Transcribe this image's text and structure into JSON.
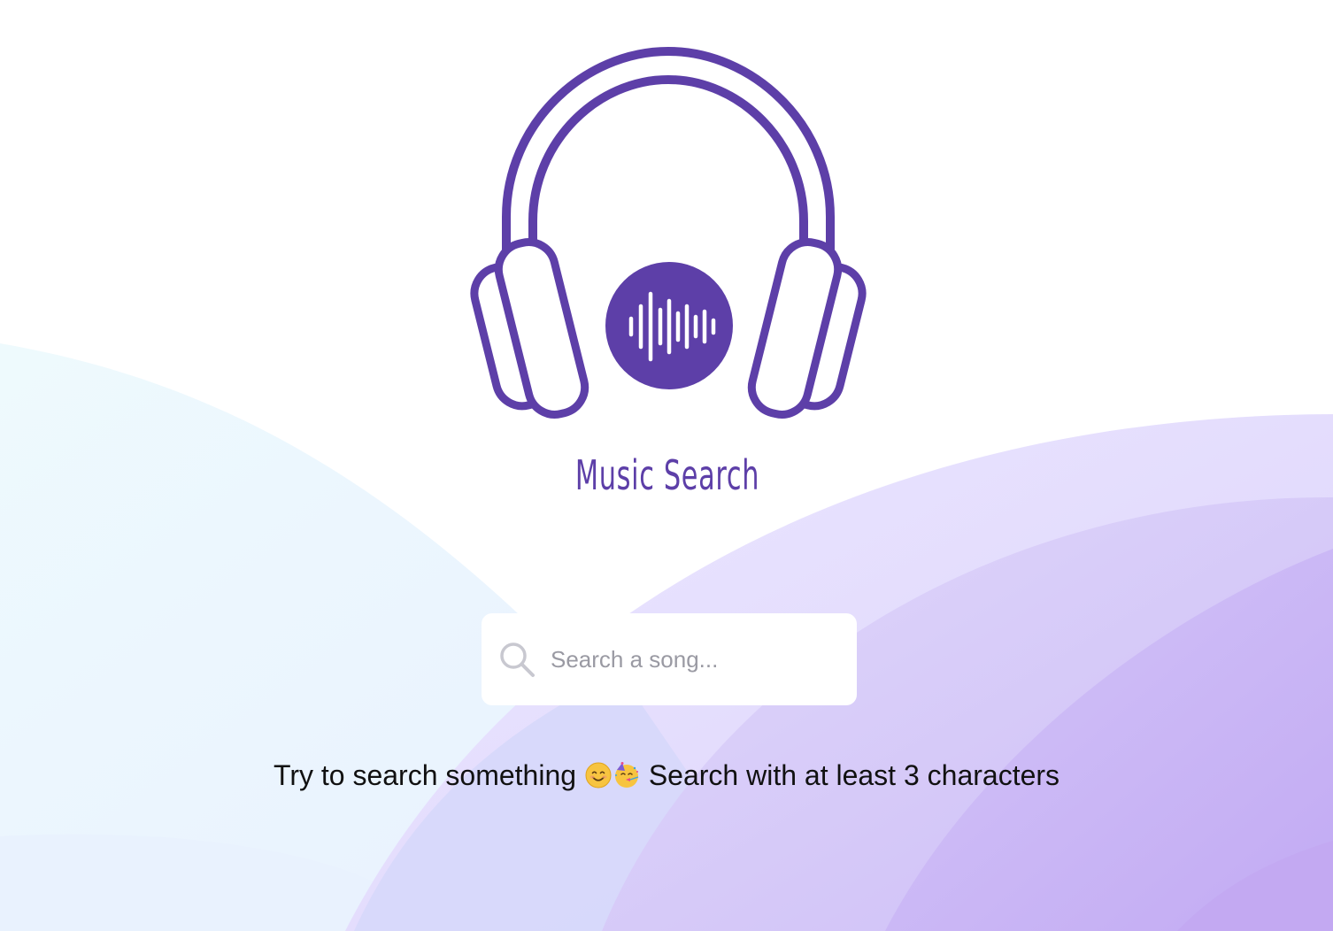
{
  "app": {
    "brand_name": "Music Search",
    "accent_color": "#5d3fa8"
  },
  "search": {
    "placeholder": "Search a song...",
    "value": "",
    "icon": "search-icon"
  },
  "hint": {
    "text_before": "Try to search something",
    "emojis": [
      "smiling-face-emoji",
      "partying-face-emoji"
    ],
    "text_after": "Search with at least 3 characters"
  },
  "logo": {
    "icon": "headphones-icon",
    "inner_icon": "sound-wave-icon"
  }
}
